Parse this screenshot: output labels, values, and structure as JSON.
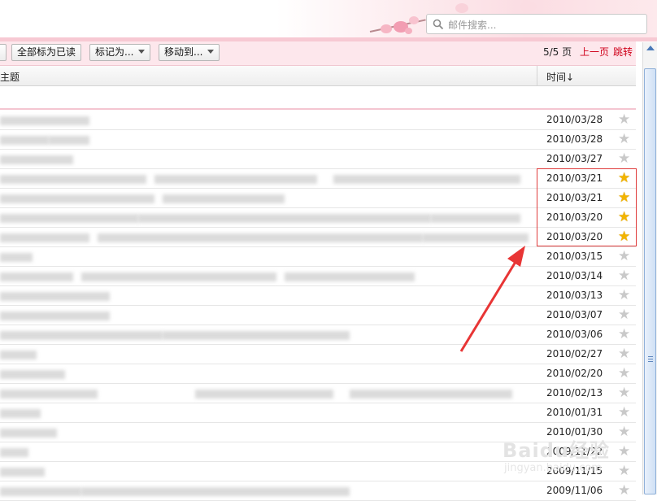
{
  "search": {
    "placeholder": "邮件搜索..."
  },
  "toolbar": {
    "mark_all_read": "全部标为已读",
    "mark_as": "标记为...",
    "move_to": "移动到...",
    "page_info": "5/5 页",
    "prev_page": "上一页",
    "jump": "跳转"
  },
  "columns": {
    "subject": "主题",
    "time": "时间↓"
  },
  "rows": [
    {
      "date": "2010/03/28",
      "starred": false
    },
    {
      "date": "2010/03/28",
      "starred": false
    },
    {
      "date": "2010/03/27",
      "starred": false
    },
    {
      "date": "2010/03/21",
      "starred": true
    },
    {
      "date": "2010/03/21",
      "starred": true
    },
    {
      "date": "2010/03/20",
      "starred": true
    },
    {
      "date": "2010/03/20",
      "starred": true
    },
    {
      "date": "2010/03/15",
      "starred": false
    },
    {
      "date": "2010/03/14",
      "starred": false
    },
    {
      "date": "2010/03/13",
      "starred": false
    },
    {
      "date": "2010/03/07",
      "starred": false
    },
    {
      "date": "2010/03/06",
      "starred": false
    },
    {
      "date": "2010/02/27",
      "starred": false
    },
    {
      "date": "2010/02/20",
      "starred": false
    },
    {
      "date": "2010/02/13",
      "starred": false
    },
    {
      "date": "2010/01/31",
      "starred": false
    },
    {
      "date": "2010/01/30",
      "starred": false
    },
    {
      "date": "2009/11/22",
      "starred": false
    },
    {
      "date": "2009/11/15",
      "starred": false
    },
    {
      "date": "2009/11/06",
      "starred": false
    }
  ],
  "star_glyph": "★",
  "star_color_on": "#f2b400",
  "star_color_off": "#c9c9c9",
  "highlight_color": "#e03c3c",
  "watermark": {
    "main": "Baidu经验",
    "sub": "jingyan.baidu.com"
  }
}
